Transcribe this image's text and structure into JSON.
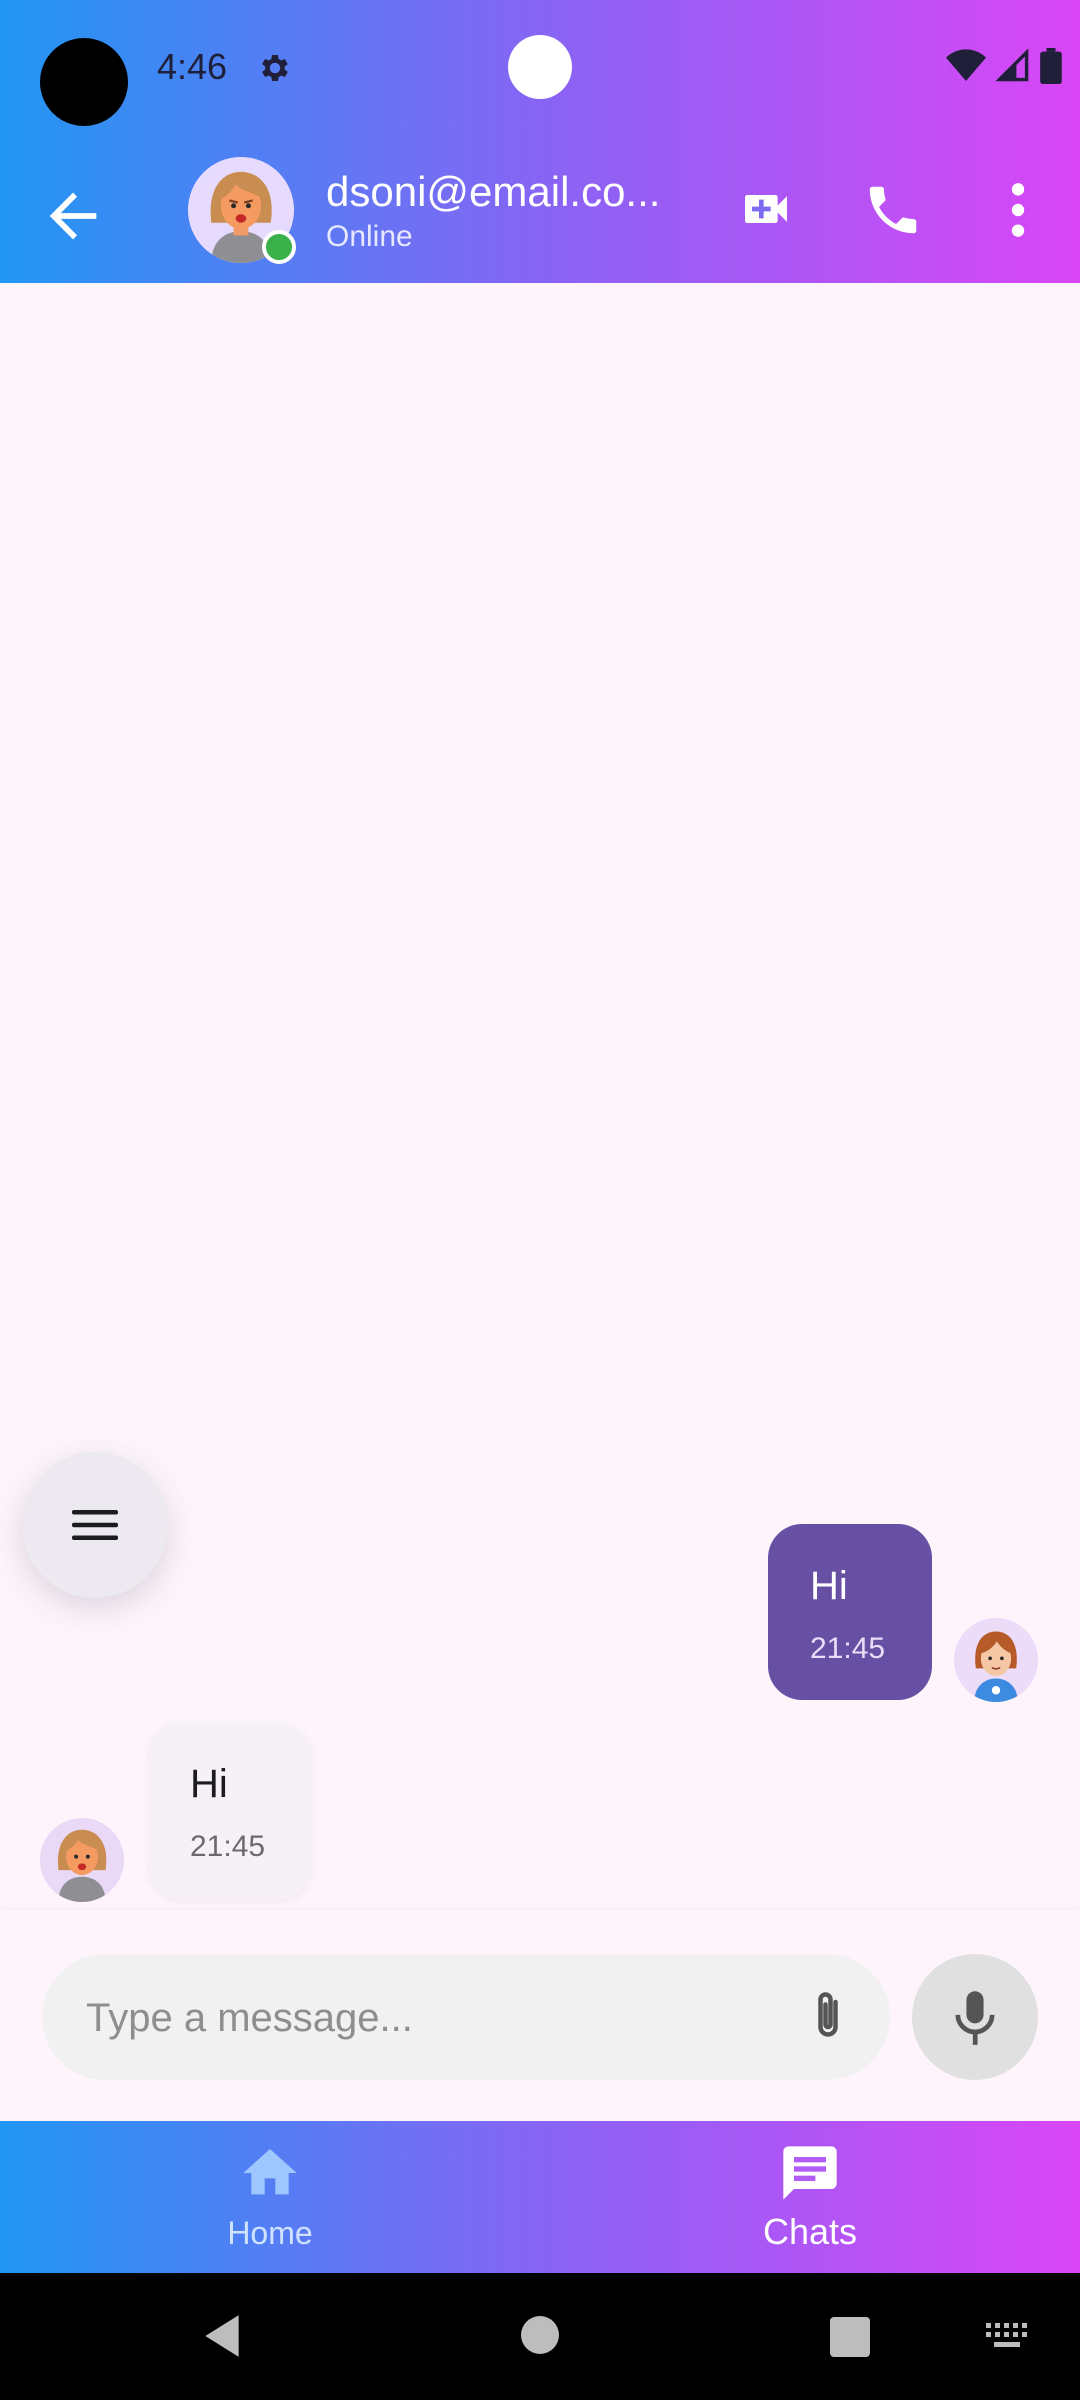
{
  "status_bar": {
    "time": "4:46"
  },
  "header": {
    "title": "dsoni@email.co...",
    "subtitle": "Online"
  },
  "messages": [
    {
      "text": "Hi",
      "time": "21:45",
      "direction": "outgoing"
    },
    {
      "text": "Hi",
      "time": "21:45",
      "direction": "incoming"
    }
  ],
  "composer": {
    "placeholder": "Type a message..."
  },
  "bottom_nav": {
    "items": [
      {
        "label": "Home",
        "icon": "home-icon"
      },
      {
        "label": "Chats",
        "icon": "chat-icon",
        "active": true
      }
    ]
  },
  "colors": {
    "gradient_start": "#2196f3",
    "gradient_end": "#d946f6",
    "outgoing_bubble": "#6750a4",
    "incoming_bubble": "#f6f1f6",
    "online": "#3bb14b"
  }
}
